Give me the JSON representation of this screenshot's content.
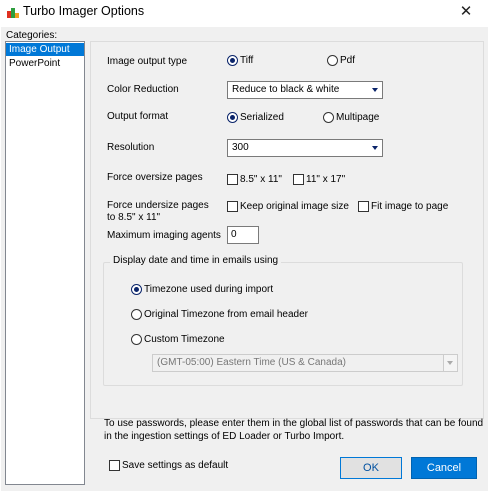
{
  "window": {
    "title": "Turbo Imager Options",
    "close_glyph": "✕"
  },
  "sidebar": {
    "label": "Categories:",
    "items": [
      {
        "label": "Image Output",
        "selected": true
      },
      {
        "label": "PowerPoint",
        "selected": false
      }
    ]
  },
  "image_output_type": {
    "label": "Image output type",
    "options": [
      {
        "label": "Tiff",
        "checked": true
      },
      {
        "label": "Pdf",
        "checked": false
      }
    ]
  },
  "color_reduction": {
    "label": "Color Reduction",
    "value": "Reduce to black & white"
  },
  "output_format": {
    "label": "Output format",
    "options": [
      {
        "label": "Serialized",
        "checked": true
      },
      {
        "label": "Multipage",
        "checked": false
      }
    ]
  },
  "resolution": {
    "label": "Resolution",
    "value": "300"
  },
  "force_oversize": {
    "label": "Force oversize pages",
    "options": [
      {
        "label": "8.5\" x 11\"",
        "checked": false
      },
      {
        "label": "11\" x 17\"",
        "checked": false
      }
    ]
  },
  "force_undersize": {
    "label_line1": "Force undersize pages",
    "label_line2": "to 8.5\" x 11\"",
    "options": [
      {
        "label": "Keep original image size",
        "checked": false
      },
      {
        "label": "Fit image to page",
        "checked": false
      }
    ]
  },
  "max_agents": {
    "label": "Maximum imaging agents",
    "value": "0"
  },
  "date_group": {
    "title": "Display date and time in emails using",
    "options": [
      {
        "label": "Timezone used during import",
        "checked": true
      },
      {
        "label": "Original Timezone from email header",
        "checked": false
      },
      {
        "label": "Custom Timezone",
        "checked": false
      }
    ],
    "timezone_value": "(GMT-05:00) Eastern Time (US & Canada)"
  },
  "info": {
    "line1": "To use passwords, please enter them in the global list of passwords that can be found",
    "line2": "in the ingestion settings of ED Loader or Turbo Import."
  },
  "footer": {
    "save_default_label": "Save settings as default",
    "ok_label": "OK",
    "cancel_label": "Cancel"
  },
  "colors": {
    "accent": "#0078d7",
    "dialog_bg": "#f0f0f0"
  }
}
